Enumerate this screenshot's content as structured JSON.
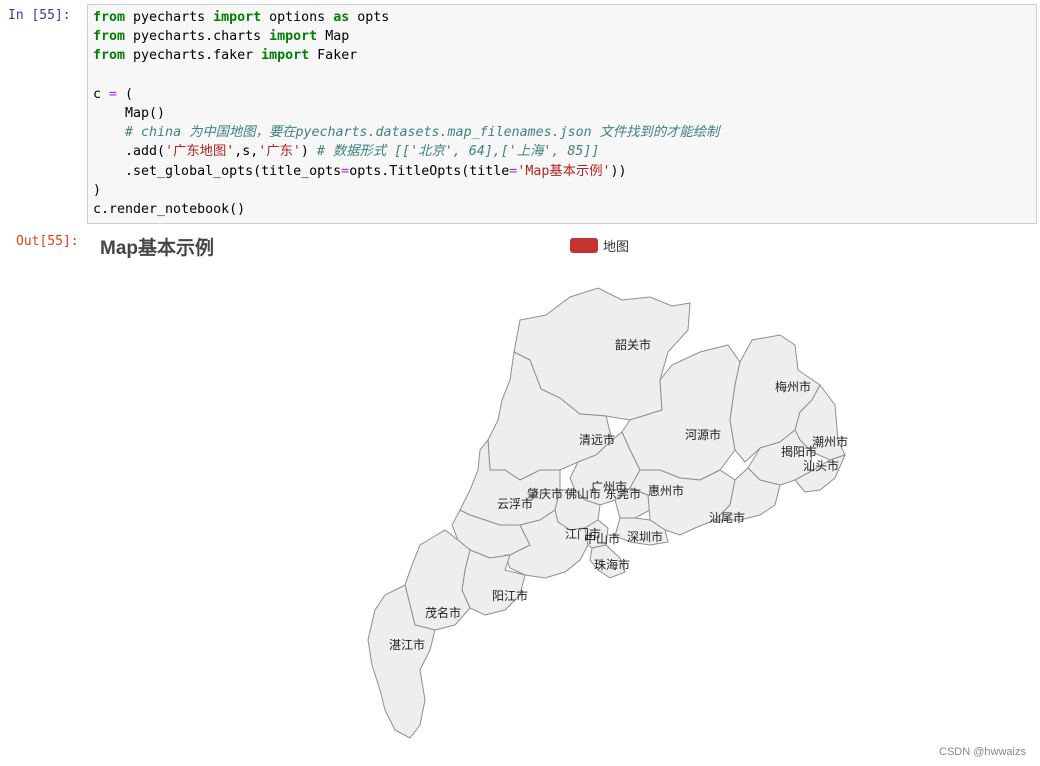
{
  "notebook": {
    "in_prompt": "In  [55]:",
    "out_prompt": "Out[55]:"
  },
  "code_lines": [
    [
      {
        "t": "from",
        "c": "kw"
      },
      {
        "t": " pyecharts "
      },
      {
        "t": "import",
        "c": "kw"
      },
      {
        "t": " options "
      },
      {
        "t": "as",
        "c": "kw"
      },
      {
        "t": " opts"
      }
    ],
    [
      {
        "t": "from",
        "c": "kw"
      },
      {
        "t": " pyecharts.charts "
      },
      {
        "t": "import",
        "c": "kw"
      },
      {
        "t": " Map"
      }
    ],
    [
      {
        "t": "from",
        "c": "kw"
      },
      {
        "t": " pyecharts.faker "
      },
      {
        "t": "import",
        "c": "kw"
      },
      {
        "t": " Faker"
      }
    ],
    [
      {
        "t": ""
      }
    ],
    [
      {
        "t": "c "
      },
      {
        "t": "=",
        "c": "op"
      },
      {
        "t": " ("
      }
    ],
    [
      {
        "t": "    Map()"
      }
    ],
    [
      {
        "t": "    "
      },
      {
        "t": "# china 为中国地图，要在pyecharts.datasets.map_filenames.json 文件找到的才能绘制",
        "c": "cm"
      }
    ],
    [
      {
        "t": "    .add("
      },
      {
        "t": "'广东地图'",
        "c": "str"
      },
      {
        "t": ",s,"
      },
      {
        "t": "'广东'",
        "c": "str"
      },
      {
        "t": ") "
      },
      {
        "t": "# 数据形式 [['北京', 64],['上海', 85]]",
        "c": "cm"
      }
    ],
    [
      {
        "t": "    .set_global_opts(title_opts"
      },
      {
        "t": "=",
        "c": "op"
      },
      {
        "t": "opts.TitleOpts(title"
      },
      {
        "t": "=",
        "c": "op"
      },
      {
        "t": "'Map基本示例'",
        "c": "str"
      },
      {
        "t": "))"
      }
    ],
    [
      {
        "t": ")"
      }
    ],
    [
      {
        "t": "c.render_notebook()"
      }
    ]
  ],
  "chart": {
    "title": "Map基本示例",
    "legend_label": "地图",
    "legend_color": "#c23531",
    "region_fill": "#eeeeee",
    "region_stroke": "#8f8f8f"
  },
  "regions": [
    {
      "id": "shaoguan",
      "name": "韶关市"
    },
    {
      "id": "qingyuan",
      "name": "清远市"
    },
    {
      "id": "heyuan",
      "name": "河源市"
    },
    {
      "id": "meizhou",
      "name": "梅州市"
    },
    {
      "id": "chaozhou",
      "name": "潮州市"
    },
    {
      "id": "jieyang",
      "name": "揭阳市"
    },
    {
      "id": "shantou",
      "name": "汕头市"
    },
    {
      "id": "zhaoqing",
      "name": "肇庆市"
    },
    {
      "id": "guangzhou",
      "name": "广州市"
    },
    {
      "id": "foshan",
      "name": "佛山市"
    },
    {
      "id": "dongguan",
      "name": "东莞市"
    },
    {
      "id": "huizhou",
      "name": "惠州市"
    },
    {
      "id": "yunfu",
      "name": "云浮市"
    },
    {
      "id": "shanwei",
      "name": "汕尾市"
    },
    {
      "id": "jiangmen",
      "name": "江门市"
    },
    {
      "id": "zhongshan",
      "name": "中山市"
    },
    {
      "id": "shenzhen",
      "name": "深圳市"
    },
    {
      "id": "zhuhai",
      "name": "珠海市"
    },
    {
      "id": "yangjiang",
      "name": "阳江市"
    },
    {
      "id": "maoming",
      "name": "茂名市"
    },
    {
      "id": "zhanjiang",
      "name": "湛江市"
    }
  ],
  "watermark": "CSDN @hwwaizs"
}
